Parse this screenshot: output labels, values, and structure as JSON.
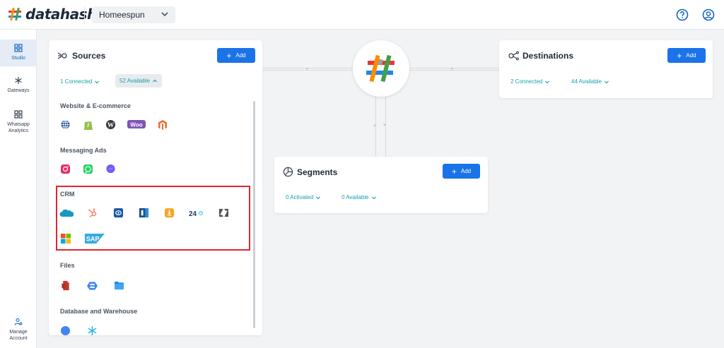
{
  "app": {
    "logo_text": "datahash",
    "workspace": "Homeespun"
  },
  "header": {
    "icons": [
      "help-icon",
      "profile-icon"
    ]
  },
  "sidebar": {
    "items": [
      {
        "label": "Studio",
        "icon": "grid-icon",
        "active": true
      },
      {
        "label": "Gateways",
        "icon": "hub-icon",
        "active": false
      },
      {
        "label": "Whatsapp Analytics",
        "icon": "grid-icon",
        "active": false
      },
      {
        "label": "Manage Account",
        "icon": "manage-account-icon",
        "active": false
      }
    ]
  },
  "sources": {
    "title": "Sources",
    "add_label": "Add",
    "connected": "1 Connected",
    "available": "52 Available",
    "sections": [
      {
        "title": "Website & E-commerce",
        "icons": [
          "globe-icon",
          "shopify-icon",
          "wordpress-icon",
          "woocommerce-icon",
          "magento-icon"
        ]
      },
      {
        "title": "Messaging Ads",
        "icons": [
          "instagram-icon",
          "whatsapp-icon",
          "messenger-icon"
        ]
      },
      {
        "title": "CRM",
        "icons": [
          "salesforce-icon",
          "hubspot-icon",
          "crm-ring-icon",
          "crm-square-icon",
          "crm-shield-icon",
          "bitrix24-icon",
          "zendesk-icon",
          "microsoft-icon",
          "sap-icon"
        ]
      },
      {
        "title": "Files",
        "icons": [
          "file-icon",
          "gcs-icon",
          "folder-icon"
        ]
      },
      {
        "title": "Database and Warehouse",
        "icons": [
          "database-icon",
          "snowflake-icon"
        ]
      }
    ],
    "crm_extra": {
      "bitrix_text": "24",
      "sap_text": "SAP"
    }
  },
  "destinations": {
    "title": "Destinations",
    "add_label": "Add",
    "connected": "2 Connected",
    "available": "44 Available"
  },
  "segments": {
    "title": "Segments",
    "add_label": "Add",
    "activated": "0 Activated",
    "available": "0 Available"
  },
  "colors": {
    "accent": "#1a73e8",
    "link": "#18a0b0",
    "highlight": "#e0262d"
  }
}
